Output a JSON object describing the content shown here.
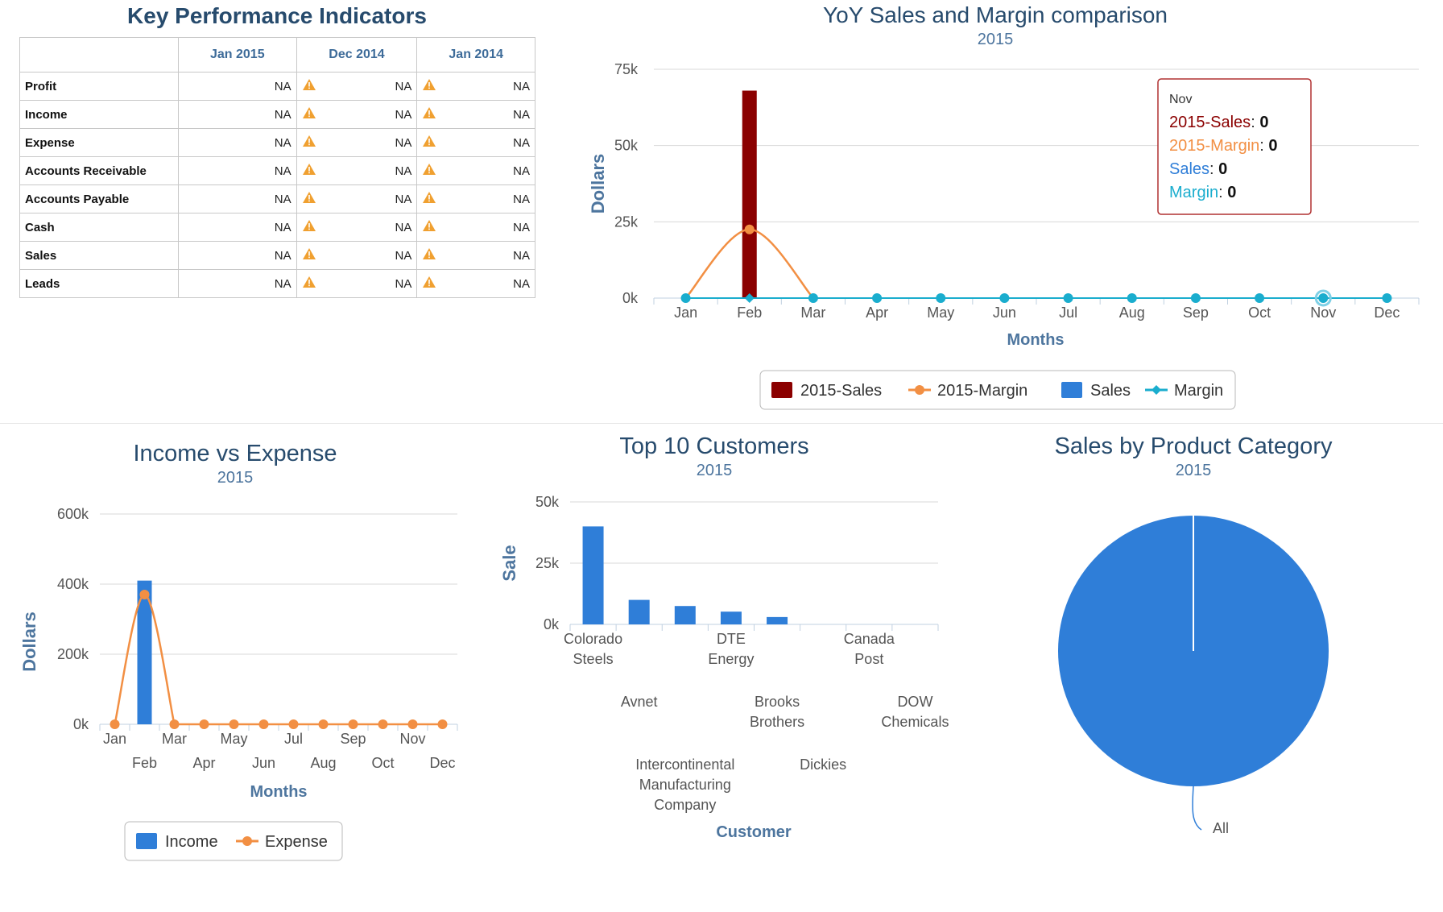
{
  "kpi": {
    "title": "Key Performance Indicators",
    "columns": [
      "Jan 2015",
      "Dec 2014",
      "Jan 2014"
    ],
    "rows": [
      {
        "label": "Profit",
        "values": [
          "NA",
          "NA",
          "NA"
        ]
      },
      {
        "label": "Income",
        "values": [
          "NA",
          "NA",
          "NA"
        ]
      },
      {
        "label": "Expense",
        "values": [
          "NA",
          "NA",
          "NA"
        ]
      },
      {
        "label": "Accounts Receivable",
        "values": [
          "NA",
          "NA",
          "NA"
        ]
      },
      {
        "label": "Accounts Payable",
        "values": [
          "NA",
          "NA",
          "NA"
        ]
      },
      {
        "label": "Cash",
        "values": [
          "NA",
          "NA",
          "NA"
        ]
      },
      {
        "label": "Sales",
        "values": [
          "NA",
          "NA",
          "NA"
        ]
      },
      {
        "label": "Leads",
        "values": [
          "NA",
          "NA",
          "NA"
        ]
      }
    ],
    "warning_icon": "warning-triangle-icon",
    "warning_color": "#f0a030"
  },
  "colors": {
    "title": "#274b6d",
    "axis_title": "#4d759e",
    "dark_red": "#8b0000",
    "orange": "#f28f43",
    "blue": "#2f7ed8",
    "cyan": "#1aadce",
    "grid": "#d8d8d8"
  },
  "chart_data": [
    {
      "id": "yoy",
      "type": "bar",
      "title": "YoY Sales and Margin comparison",
      "subtitle": "2015",
      "xlabel": "Months",
      "ylabel": "Dollars",
      "categories": [
        "Jan",
        "Feb",
        "Mar",
        "Apr",
        "May",
        "Jun",
        "Jul",
        "Aug",
        "Sep",
        "Oct",
        "Nov",
        "Dec"
      ],
      "ylim": [
        0,
        75000
      ],
      "yticks": [
        "0k",
        "25k",
        "50k",
        "75k"
      ],
      "series": [
        {
          "name": "2015-Sales",
          "kind": "bar",
          "values": [
            0,
            68000,
            0,
            0,
            0,
            0,
            0,
            0,
            0,
            0,
            0,
            0
          ]
        },
        {
          "name": "2015-Margin",
          "kind": "spline",
          "values": [
            0,
            22500,
            0,
            0,
            0,
            0,
            0,
            0,
            0,
            0,
            0,
            0
          ]
        },
        {
          "name": "Sales",
          "kind": "bar",
          "values": [
            0,
            0,
            0,
            0,
            0,
            0,
            0,
            0,
            0,
            0,
            0,
            0
          ]
        },
        {
          "name": "Margin",
          "kind": "line",
          "values": [
            0,
            0,
            0,
            0,
            0,
            0,
            0,
            0,
            0,
            0,
            0,
            0
          ]
        }
      ],
      "tooltip": {
        "header": "Nov",
        "lines": [
          {
            "name": "2015-Sales",
            "value": "0"
          },
          {
            "name": "2015-Margin",
            "value": "0"
          },
          {
            "name": "Sales",
            "value": "0"
          },
          {
            "name": "Margin",
            "value": "0"
          }
        ]
      },
      "legend_position": "bottom-center"
    },
    {
      "id": "income_expense",
      "type": "bar",
      "title": "Income vs Expense",
      "subtitle": "2015",
      "xlabel": "Months",
      "ylabel": "Dollars",
      "categories": [
        "Jan",
        "Feb",
        "Mar",
        "Apr",
        "May",
        "Jun",
        "Jul",
        "Aug",
        "Sep",
        "Oct",
        "Nov",
        "Dec"
      ],
      "ylim": [
        0,
        600000
      ],
      "yticks": [
        "0k",
        "200k",
        "400k",
        "600k"
      ],
      "series": [
        {
          "name": "Income",
          "kind": "bar",
          "values": [
            0,
            410000,
            0,
            0,
            0,
            0,
            0,
            0,
            0,
            0,
            0,
            0
          ]
        },
        {
          "name": "Expense",
          "kind": "spline",
          "values": [
            0,
            370000,
            0,
            0,
            0,
            0,
            0,
            0,
            0,
            0,
            0,
            0
          ]
        }
      ],
      "legend_position": "bottom-center"
    },
    {
      "id": "top_customers",
      "type": "bar",
      "title": "Top 10 Customers",
      "subtitle": "2015",
      "xlabel": "Customer",
      "ylabel": "Sale",
      "ylim": [
        0,
        50000
      ],
      "yticks": [
        "0k",
        "25k",
        "50k"
      ],
      "categories": [
        "Colorado Steels",
        "Avnet",
        "Intercontinental Manufacturing Company",
        "DTE Energy",
        "Brooks Brothers",
        "Dickies",
        "Canada Post",
        "DOW Chemicals"
      ],
      "category_lines": [
        [
          "Colorado",
          "Steels"
        ],
        [
          "Avnet"
        ],
        [
          "Intercontinental",
          "Manufacturing",
          "Company"
        ],
        [
          "DTE",
          "Energy"
        ],
        [
          "Brooks",
          "Brothers"
        ],
        [
          "Dickies"
        ],
        [
          "Canada",
          "Post"
        ],
        [
          "DOW",
          "Chemicals"
        ]
      ],
      "values": [
        40000,
        10000,
        7500,
        5200,
        3000,
        0,
        0,
        0
      ]
    },
    {
      "id": "product_category",
      "type": "pie",
      "title": "Sales by Product Category",
      "subtitle": "2015",
      "slices": [
        {
          "name": "All",
          "value": 100
        }
      ]
    }
  ]
}
